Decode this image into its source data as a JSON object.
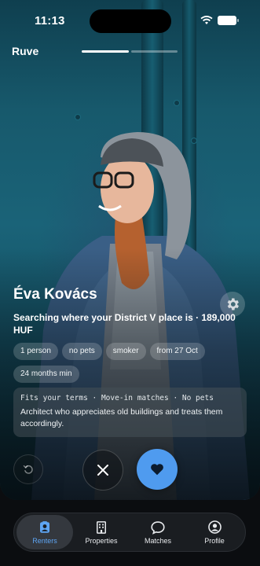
{
  "status_bar": {
    "time": "11:13"
  },
  "app": {
    "brand": "Ruve",
    "photo_progress": {
      "current": 1,
      "total": 2
    }
  },
  "profile": {
    "name": "Éva Kovács",
    "summary": "Searching where your District V place is · 189,000 HUF",
    "chips": [
      "1 person",
      "no pets",
      "smoker",
      "from 27 Oct",
      "24 months min"
    ],
    "info_meta": "Fits your terms · Move-in matches · No pets",
    "bio": "Architect who appreciates old buildings and treats them accordingly."
  },
  "actions": {
    "undo_icon": "undo-icon",
    "pass_icon": "close-icon",
    "like_icon": "heart-icon",
    "like_color": "#4f9bef"
  },
  "tabs": [
    {
      "label": "Renters",
      "icon": "renters-icon",
      "active": true
    },
    {
      "label": "Properties",
      "icon": "building-icon",
      "active": false
    },
    {
      "label": "Matches",
      "icon": "chat-bubble-icon",
      "active": false
    },
    {
      "label": "Profile",
      "icon": "user-circle-icon",
      "active": false
    }
  ],
  "colors": {
    "accent": "#5ea5f3",
    "card_bg": "#17596c"
  }
}
